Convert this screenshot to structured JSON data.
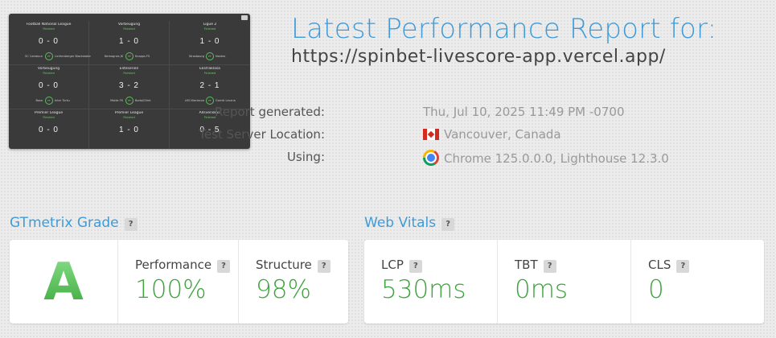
{
  "thumbnail": {
    "matches": [
      {
        "league": "Football National League",
        "status": "Finished",
        "score": "0 - 0",
        "home": "SC Cambuur",
        "away": "Lichtenberger Blackwater",
        "time": "FT"
      },
      {
        "league": "Vorbeugung",
        "status": "Finished",
        "score": "1 - 0",
        "home": "Nemagnes JK",
        "away": "Knapps FS",
        "time": "FT"
      },
      {
        "league": "Ligue 2",
        "status": "Finished",
        "score": "1 - 0",
        "home": "Strasbourg",
        "away": "Nantes",
        "time": "FT"
      },
      {
        "league": "Vorbeugung",
        "status": "Finished",
        "score": "0 - 0",
        "home": "Bosa",
        "away": "Inter Turku",
        "time": "FT"
      },
      {
        "league": "Eliteserien",
        "status": "Finished",
        "score": "3 - 2",
        "home": "Molde FK",
        "away": "Bodo/Glimt",
        "time": "FT"
      },
      {
        "league": "Ekstraklasa",
        "status": "Finished",
        "score": "2 - 1",
        "home": "LKS Nieciecza",
        "away": "Gornik Leczna",
        "time": "FT"
      },
      {
        "league": "Premier League",
        "status": "Finished",
        "score": "0 - 0",
        "home": "",
        "away": "",
        "time": ""
      },
      {
        "league": "Premier League",
        "status": "Finished",
        "score": "1 - 0",
        "home": "",
        "away": "",
        "time": ""
      },
      {
        "league": "Allsvenskan",
        "status": "Finished",
        "score": "0 - 5",
        "home": "",
        "away": "",
        "time": ""
      }
    ]
  },
  "report": {
    "title": "Latest Performance Report for:",
    "url": "https://spinbet-livescore-app.vercel.app/"
  },
  "meta": {
    "generated_label": "Report generated:",
    "generated_value": "Thu, Jul 10, 2025 11:49 PM -0700",
    "location_label": "Test Server Location:",
    "location_value": "Vancouver, Canada",
    "location_icon": "canada-flag-icon",
    "using_label": "Using:",
    "using_value": "Chrome 125.0.0.0, Lighthouse 12.3.0",
    "using_icon": "chrome-icon"
  },
  "grade_section": {
    "title": "GTmetrix Grade",
    "help": "?",
    "grade": "A",
    "performance_label": "Performance",
    "performance_value": "100%",
    "structure_label": "Structure",
    "structure_value": "98%"
  },
  "vitals_section": {
    "title": "Web Vitals",
    "help": "?",
    "lcp_label": "LCP",
    "lcp_value": "530ms",
    "tbt_label": "TBT",
    "tbt_value": "0ms",
    "cls_label": "CLS",
    "cls_value": "0"
  },
  "colors": {
    "accent_blue": "#3f9bd8",
    "good_green": "#3ca53c",
    "grade_green": "#4cbb4c"
  }
}
